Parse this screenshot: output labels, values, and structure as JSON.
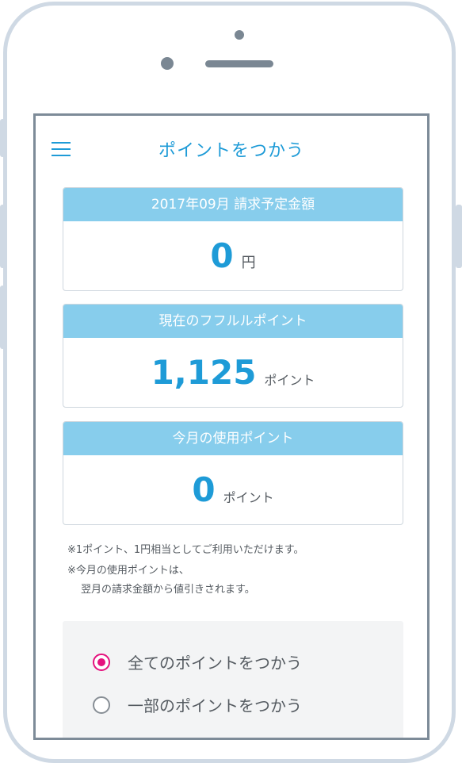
{
  "header": {
    "title": "ポイントをつかう"
  },
  "billing": {
    "heading": "2017年09月 請求予定金額",
    "amount": "0",
    "unit": "円"
  },
  "current_points": {
    "heading": "現在のフフルルポイント",
    "value": "1,125",
    "unit": "ポイント"
  },
  "used_points": {
    "heading": "今月の使用ポイント",
    "value": "0",
    "unit": "ポイント"
  },
  "notes": {
    "line1": "※1ポイント、1円相当としてご利用いただけます。",
    "line2": "※今月の使用ポイントは、",
    "line3": "翌月の請求金額から値引きされます。"
  },
  "options": {
    "all_label": "全てのポイントをつかう",
    "partial_label": "一部のポイントをつかう",
    "selected": "all"
  },
  "colors": {
    "accent": "#1e9bd7",
    "card_header": "#87cdec",
    "radio_selected": "#e5127e"
  },
  "icons": {
    "menu": "hamburger-menu-icon"
  }
}
